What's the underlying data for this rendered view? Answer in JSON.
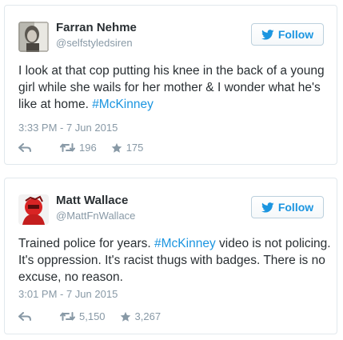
{
  "tweets": [
    {
      "name": "Farran Nehme",
      "handle": "@selfstyledsiren",
      "follow_label": "Follow",
      "text_parts": [
        "I look at that cop putting his knee in the back of a young girl while she wails for her mother & I wonder what he's like at home. ",
        "#McKinney"
      ],
      "timestamp": "3:33 PM - 7 Jun 2015",
      "retweets": "196",
      "favorites": "175"
    },
    {
      "name": "Matt Wallace",
      "handle": "@MattFnWallace",
      "follow_label": "Follow",
      "text_parts": [
        "Trained police for years. ",
        "#McKinney",
        " video is not policing. It's oppression. It's racist thugs with badges. There is no excuse, no reason."
      ],
      "timestamp": "3:01 PM - 7 Jun 2015",
      "retweets": "5,150",
      "favorites": "3,267"
    }
  ],
  "icons": {
    "follow": "twitter-bird-icon",
    "reply": "reply-arrow-icon",
    "retweet": "retweet-icon",
    "favorite": "star-icon"
  },
  "colors": {
    "accent": "#1b95e0",
    "text": "#292f33",
    "muted": "#8899a6",
    "border": "#e1e8ed"
  }
}
